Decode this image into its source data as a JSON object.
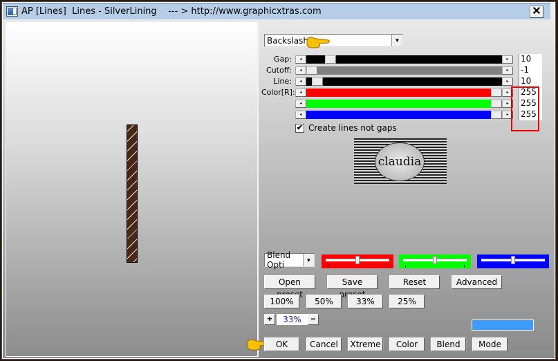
{
  "window": {
    "title": "AP [Lines]  Lines - SilverLining    --- > http://www.graphicxtras.com",
    "close_label": "✕"
  },
  "mode_select": {
    "value": "Backslash"
  },
  "sliders": [
    {
      "label": "Gap:",
      "value": "10",
      "track_color": "#000000",
      "position": 0.1
    },
    {
      "label": "Cutoff:",
      "value": "-1",
      "track_color": "#808080",
      "position": 0.0
    },
    {
      "label": "Line:",
      "value": "10",
      "track_color": "#000000",
      "position": 0.03
    },
    {
      "label": "Color[R]:",
      "value": "255",
      "track_color": "#ff0000",
      "position": 1.0
    },
    {
      "label": "",
      "value": "255",
      "track_color": "#00ff00",
      "position": 1.0
    },
    {
      "label": "",
      "value": "255",
      "track_color": "#0000ff",
      "position": 1.0
    }
  ],
  "checkbox": {
    "label": "Create lines not gaps",
    "checked": true,
    "mark": "✔"
  },
  "logo": {
    "text": "claudia"
  },
  "blend_select": {
    "value": "Blend Opti"
  },
  "color_sliders": [
    {
      "name": "red",
      "color": "#ff0000",
      "position": 0.5
    },
    {
      "name": "green",
      "color": "#00ff00",
      "position": 0.5
    },
    {
      "name": "blue",
      "color": "#0000ff",
      "position": 0.5
    }
  ],
  "preset_buttons": {
    "open": "Open preset",
    "save": "Save preset",
    "reset": "Reset",
    "advanced": "Advanced"
  },
  "zoom_buttons": [
    "100%",
    "50%",
    "33%",
    "25%"
  ],
  "zoom_control": {
    "plus": "+",
    "value": "33%",
    "minus": "−"
  },
  "swatch_color": "#3b9bff",
  "bottom_buttons": {
    "ok": "OK",
    "cancel": "Cancel",
    "xtreme": "Xtreme",
    "color": "Color",
    "blend": "Blend",
    "mode": "Mode"
  },
  "arrows": {
    "left": "◂",
    "right": "▸",
    "down": "▼"
  }
}
